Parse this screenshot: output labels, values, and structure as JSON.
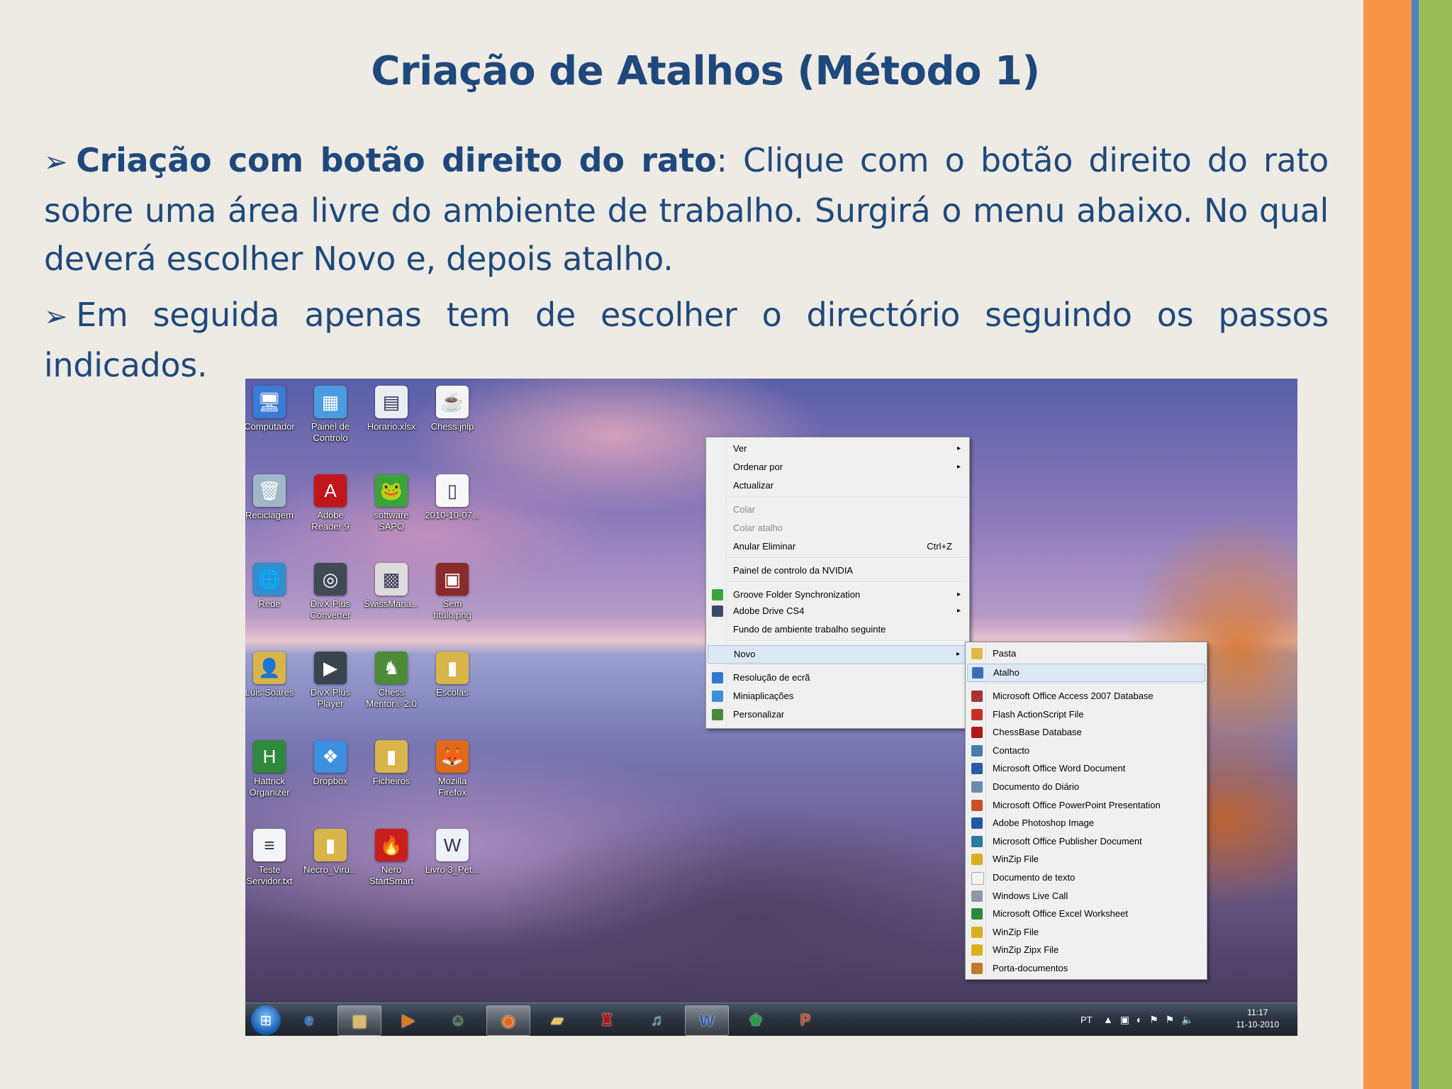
{
  "slide": {
    "title": "Criação de Atalhos (Método 1)",
    "bullet_glyph": "➢",
    "para1_bold": "Criação com botão direito do rato",
    "para1_rest": ": Clique com o botão direito do rato sobre uma área livre do ambiente de trabalho. Surgirá o menu abaixo. No qual deverá escolher Novo e, depois atalho.",
    "para2": "Em seguida apenas tem de escolher o directório seguindo os passos indicados."
  },
  "desktop_icons": [
    {
      "label": "Computador",
      "icon": "computer-icon",
      "color": "#3a7bd5",
      "glyph": "🖥"
    },
    {
      "label": "Painel de Controlo",
      "icon": "control-panel-icon",
      "color": "#4a9be0",
      "glyph": "▦"
    },
    {
      "label": "Horario.xlsx",
      "icon": "excel-file-icon",
      "color": "#e8eef4",
      "glyph": "▤"
    },
    {
      "label": "Chess.jnlp",
      "icon": "java-file-icon",
      "color": "#f4f4f4",
      "glyph": "☕"
    },
    {
      "label": "Reciclagem",
      "icon": "recycle-bin-icon",
      "color": "#9fb8c8",
      "glyph": "🗑"
    },
    {
      "label": "Adobe Reader 9",
      "icon": "adobe-reader-icon",
      "color": "#c0161b",
      "glyph": "A"
    },
    {
      "label": "software SAPO",
      "icon": "sapo-icon",
      "color": "#3aa43a",
      "glyph": "🐸"
    },
    {
      "label": "2010-10-07...",
      "icon": "file-icon",
      "color": "#f8f8f8",
      "glyph": "▯"
    },
    {
      "label": "Rede",
      "icon": "network-icon",
      "color": "#2f8fd0",
      "glyph": "🌐"
    },
    {
      "label": "DivX Plus Converter",
      "icon": "divx-converter-icon",
      "color": "#404a55",
      "glyph": "◎"
    },
    {
      "label": "SwissMana...",
      "icon": "swissmanager-icon",
      "color": "#dcdcdc",
      "glyph": "▩"
    },
    {
      "label": "Sem título.png",
      "icon": "image-file-icon",
      "color": "#8a2b2b",
      "glyph": "▣"
    },
    {
      "label": "Luis Soares",
      "icon": "user-folder-icon",
      "color": "#d9b44a",
      "glyph": "👤"
    },
    {
      "label": "DivX Plus Player",
      "icon": "divx-player-icon",
      "color": "#3a444f",
      "glyph": "▶"
    },
    {
      "label": "Chess Mentor® 2.0",
      "icon": "chess-mentor-icon",
      "color": "#4d8a3a",
      "glyph": "♞"
    },
    {
      "label": "Escolas",
      "icon": "folder-icon",
      "color": "#d9b44a",
      "glyph": "▮"
    },
    {
      "label": "Hattrick Organizer",
      "icon": "hattrick-icon",
      "color": "#2e8a3a",
      "glyph": "H"
    },
    {
      "label": "Dropbox",
      "icon": "dropbox-icon",
      "color": "#3d8fe0",
      "glyph": "❖"
    },
    {
      "label": "Ficheiros",
      "icon": "folder-icon",
      "color": "#d9b44a",
      "glyph": "▮"
    },
    {
      "label": "Mozilla Firefox",
      "icon": "firefox-icon",
      "color": "#e06a1a",
      "glyph": "🦊"
    },
    {
      "label": "Teste Servidor.txt",
      "icon": "text-file-icon",
      "color": "#f4f4f4",
      "glyph": "≡"
    },
    {
      "label": "Necro_Viru...",
      "icon": "folder-icon",
      "color": "#d9b44a",
      "glyph": "▮"
    },
    {
      "label": "Nero StartSmart",
      "icon": "nero-icon",
      "color": "#c81e1e",
      "glyph": "🔥"
    },
    {
      "label": "Livro 3_Pet...",
      "icon": "word-file-icon",
      "color": "#eef2f8",
      "glyph": "W"
    }
  ],
  "context_menu": {
    "items": [
      {
        "label": "Ver",
        "arrow": "▸"
      },
      {
        "label": "Ordenar por",
        "arrow": "▸"
      },
      {
        "label": "Actualizar"
      },
      {
        "label": "Colar"
      },
      {
        "label": "Colar atalho"
      },
      {
        "label": "Anular Eliminar",
        "shortcut": "Ctrl+Z"
      },
      {
        "label": "Painel de controlo da NVIDIA"
      },
      {
        "label": "Groove Folder Synchronization",
        "arrow": "▸",
        "icon": "groove-icon",
        "color": "#3aa43a"
      },
      {
        "label": "Adobe Drive CS4",
        "arrow": "▸",
        "icon": "adobe-drive-icon",
        "color": "#3b4a6b"
      },
      {
        "label": "Fundo de ambiente trabalho seguinte"
      },
      {
        "label": "Novo",
        "arrow": "▸"
      },
      {
        "label": "Resolução de ecrã",
        "icon": "display-icon",
        "color": "#2f7ad0"
      },
      {
        "label": "Miniaplicações",
        "icon": "gadgets-icon",
        "color": "#3a8fd8"
      },
      {
        "label": "Personalizar",
        "icon": "personalize-icon",
        "color": "#4a8a3a"
      }
    ]
  },
  "sub_menu": {
    "items": [
      {
        "label": "Pasta",
        "icon": "folder-icon",
        "color": "#e0b84a"
      },
      {
        "label": "Atalho",
        "icon": "shortcut-icon",
        "color": "#3a6fb8"
      },
      {
        "label": "Microsoft Office Access 2007 Database",
        "icon": "access-icon",
        "color": "#a8323a"
      },
      {
        "label": "Flash ActionScript File",
        "icon": "flash-icon",
        "color": "#c8302a"
      },
      {
        "label": "ChessBase Database",
        "icon": "chessbase-icon",
        "color": "#b01818"
      },
      {
        "label": "Contacto",
        "icon": "contact-icon",
        "color": "#4a7ab0"
      },
      {
        "label": "Microsoft Office Word Document",
        "icon": "word-icon",
        "color": "#2b5aa8"
      },
      {
        "label": "Documento do Diário",
        "icon": "journal-icon",
        "color": "#6a8ab0"
      },
      {
        "label": "Microsoft Office PowerPoint Presentation",
        "icon": "powerpoint-icon",
        "color": "#c8502a"
      },
      {
        "label": "Adobe Photoshop Image",
        "icon": "photoshop-icon",
        "color": "#1e5aa0"
      },
      {
        "label": "Microsoft Office Publisher Document",
        "icon": "publisher-icon",
        "color": "#2a7a9a"
      },
      {
        "label": "WinZip File",
        "icon": "winzip-icon",
        "color": "#d8b020"
      },
      {
        "label": "Documento de texto",
        "icon": "text-document-icon",
        "color": "#f4f4f4"
      },
      {
        "label": "Windows Live Call",
        "icon": "live-call-icon",
        "color": "#8a9aa8"
      },
      {
        "label": "Microsoft Office Excel Worksheet",
        "icon": "excel-icon",
        "color": "#2a8a3a"
      },
      {
        "label": "WinZip File",
        "icon": "winzip-icon",
        "color": "#d8b020"
      },
      {
        "label": "WinZip Zipx File",
        "icon": "winzip-icon",
        "color": "#d8b020"
      },
      {
        "label": "Porta-documentos",
        "icon": "briefcase-icon",
        "color": "#c07a2a"
      }
    ]
  },
  "taskbar": {
    "start_glyph": "⊞",
    "buttons": [
      {
        "icon": "internet-explorer-icon",
        "glyph": "e",
        "color": "#1e78d8"
      },
      {
        "icon": "explorer-icon",
        "glyph": "▤",
        "color": "#e0b84a"
      },
      {
        "icon": "media-player-icon",
        "glyph": "▶",
        "color": "#e07a1a"
      },
      {
        "icon": "messenger-icon",
        "glyph": "☺",
        "color": "#3aa43a"
      },
      {
        "icon": "firefox-icon",
        "glyph": "◉",
        "color": "#e06a1a"
      },
      {
        "icon": "folder-window-icon",
        "glyph": "▰",
        "color": "#e8c860"
      },
      {
        "icon": "chessbase-icon",
        "glyph": "♜",
        "color": "#b01818"
      },
      {
        "icon": "itunes-icon",
        "glyph": "♫",
        "color": "#5aa0e0"
      },
      {
        "icon": "word-icon",
        "glyph": "W",
        "color": "#2b5aa8"
      },
      {
        "icon": "chess-app-icon",
        "glyph": "♚",
        "color": "#2a9a4a"
      },
      {
        "icon": "powerpoint-icon",
        "glyph": "P",
        "color": "#d0502a"
      }
    ],
    "language": "PT",
    "tray_glyphs": "▲ ▣ ◐ ⚑ ⚑ 🔈",
    "time": "11:17",
    "date": "11-10-2010"
  },
  "colors": {
    "title": "#1f497d",
    "orange_stripe": "#f79646",
    "blue_stripe": "#4f81bd",
    "green_stripe": "#9bbb59"
  }
}
